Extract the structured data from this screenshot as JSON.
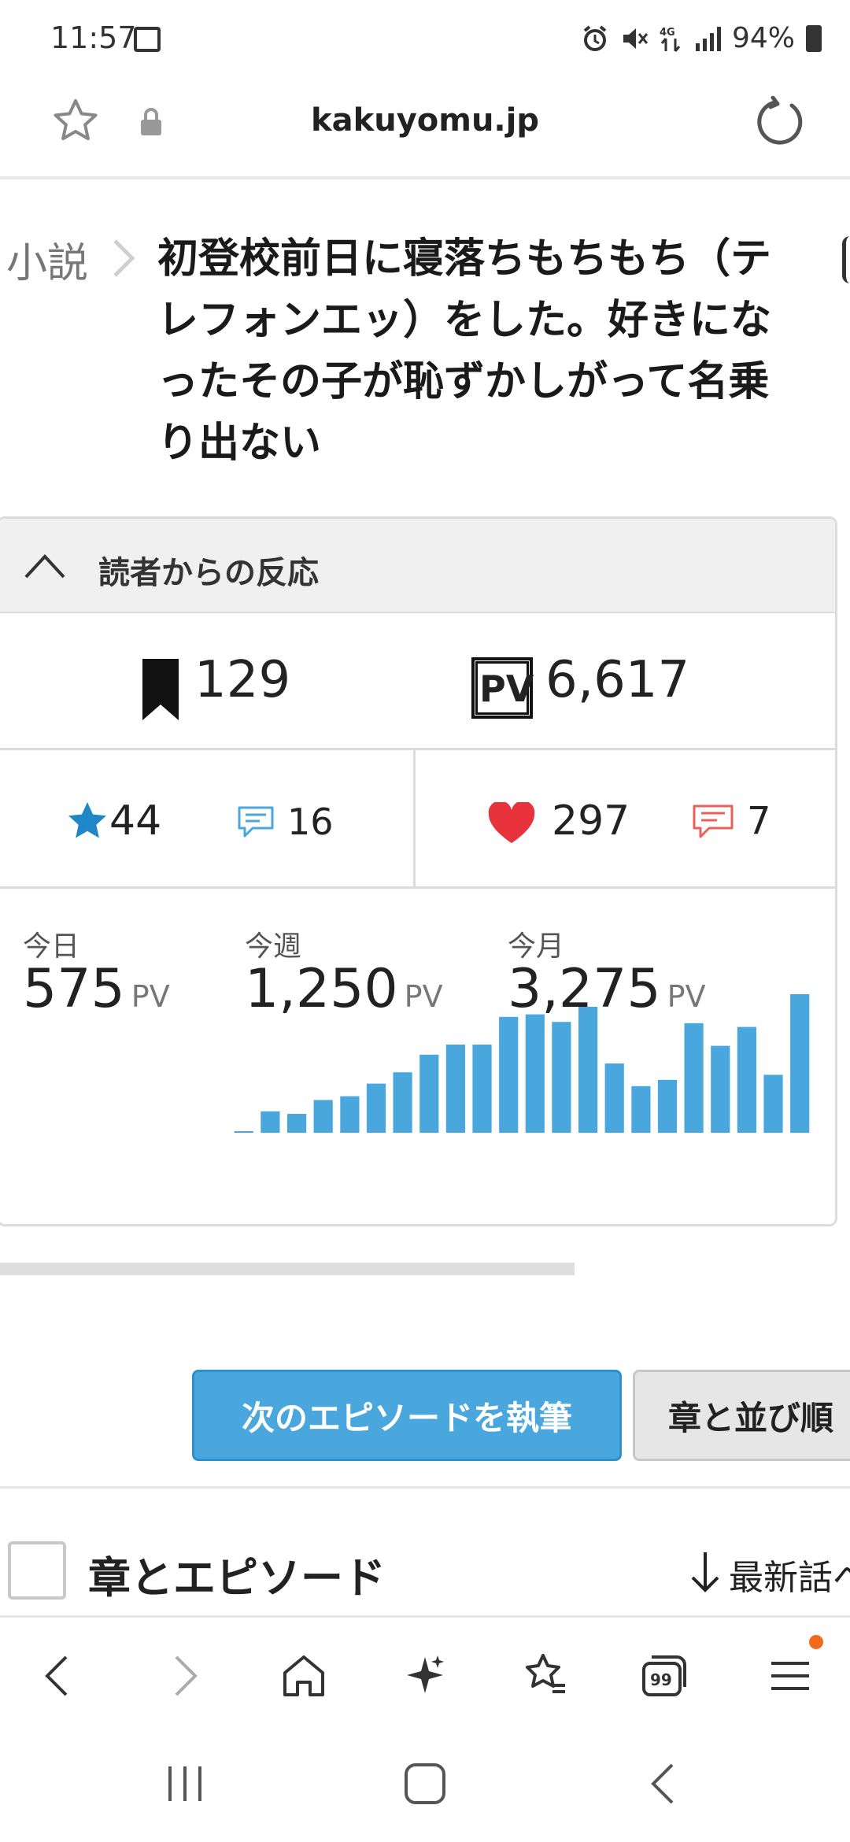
{
  "status_bar": {
    "time": "11:57",
    "battery": "94%"
  },
  "url_bar": {
    "domain": "kakuyomu.jp"
  },
  "breadcrumb": {
    "parent": "小説"
  },
  "title": "初登校前日に寝落ちもちもち（テレフォンエッ）をした。好きになったその子が恥ずかしがって名乗り出ない",
  "reactions": {
    "heading": "読者からの反応",
    "bookmarks": "129",
    "pv_badge": "PV",
    "pv_total": "6,617",
    "stars": "44",
    "reviews": "16",
    "hearts": "297",
    "comments": "7",
    "today": {
      "label": "今日",
      "value": "575",
      "unit": "PV"
    },
    "week": {
      "label": "今週",
      "value": "1,250",
      "unit": "PV"
    },
    "month": {
      "label": "今月",
      "value": "3,275",
      "unit": "PV"
    }
  },
  "chart_data": {
    "type": "bar",
    "values": [
      1,
      17,
      15,
      26,
      29,
      39,
      48,
      62,
      70,
      70,
      92,
      94,
      88,
      100,
      55,
      37,
      42,
      87,
      69,
      84,
      46,
      110
    ],
    "color": "#4aa7dd"
  },
  "buttons": {
    "write_next": "次のエピソードを執筆",
    "chapter_order": "章と並び順"
  },
  "section": {
    "title": "章とエピソード",
    "sort": "最新話へ"
  },
  "colors": {
    "accent": "#4aa7dd",
    "heart": "#e8323c",
    "comment": "#e8625a",
    "star": "#1f87c7"
  }
}
